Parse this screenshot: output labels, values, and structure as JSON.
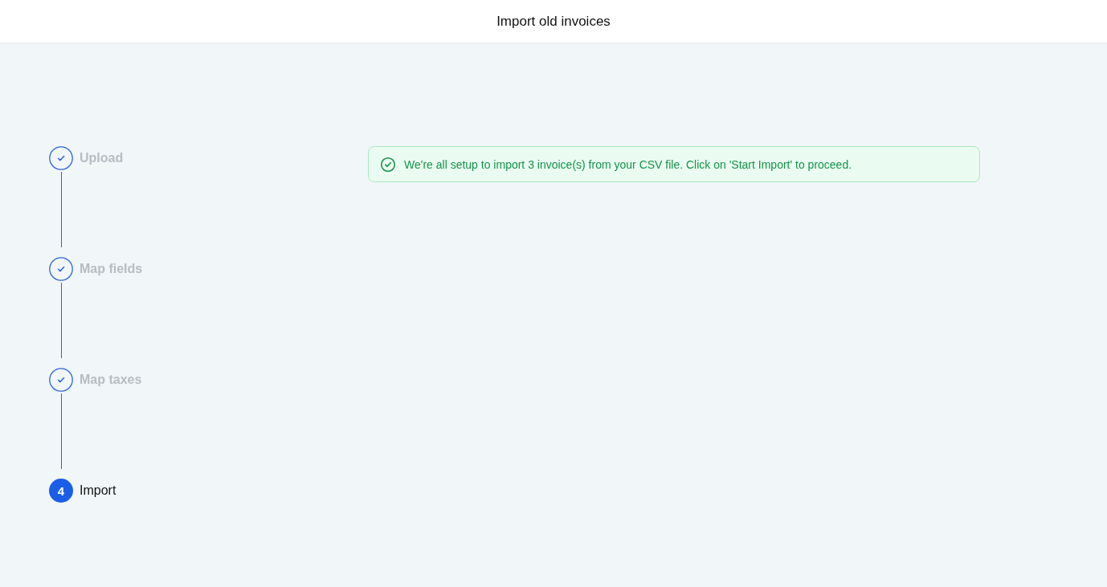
{
  "header": {
    "title": "Import old invoices"
  },
  "steps": [
    {
      "label": "Upload",
      "completed": true
    },
    {
      "label": "Map fields",
      "completed": true
    },
    {
      "label": "Map taxes",
      "completed": true
    },
    {
      "label": "Import",
      "completed": false,
      "number": "4"
    }
  ],
  "alert": {
    "kind": "success",
    "message": "We're all setup to import 3 invoice(s) from your CSV file. Click on 'Start Import' to proceed."
  }
}
